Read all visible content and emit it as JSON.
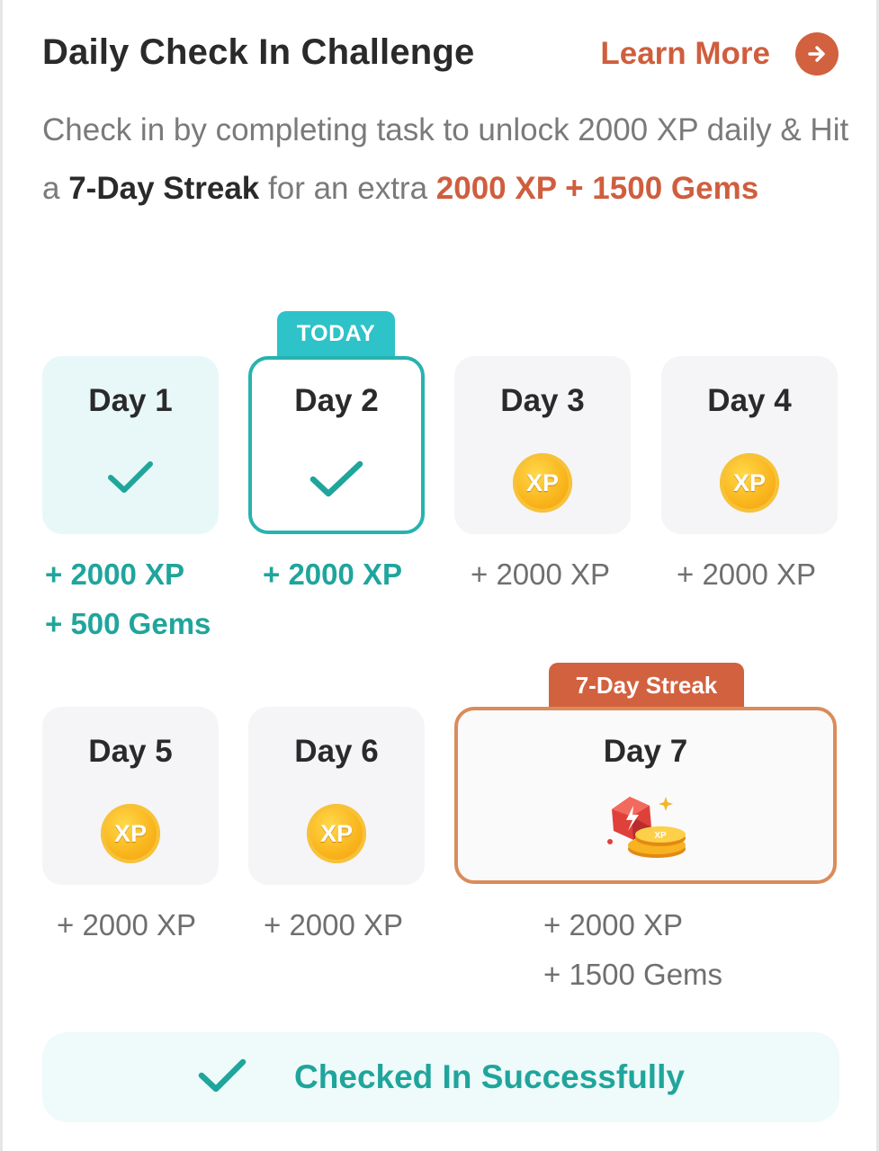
{
  "header": {
    "title": "Daily Check In Challenge",
    "learn_more": "Learn More"
  },
  "description": {
    "part1": "Check in by completing task to unlock 2000 XP daily & Hit a ",
    "streak": "7-Day Streak",
    "part2": " for an extra ",
    "bonus": "2000 XP + 1500 Gems"
  },
  "days": [
    {
      "label": "Day 1",
      "status": "checked",
      "reward_xp": "+ 2000 XP",
      "reward_gems": "+ 500 Gems"
    },
    {
      "label": "Day 2",
      "status": "checked-today",
      "badge": "TODAY",
      "reward_xp": "+ 2000 XP"
    },
    {
      "label": "Day 3",
      "status": "pending",
      "icon_text": "XP",
      "reward_xp": "+ 2000 XP"
    },
    {
      "label": "Day 4",
      "status": "pending",
      "icon_text": "XP",
      "reward_xp": "+ 2000 XP"
    },
    {
      "label": "Day 5",
      "status": "pending",
      "icon_text": "XP",
      "reward_xp": "+ 2000 XP"
    },
    {
      "label": "Day 6",
      "status": "pending",
      "icon_text": "XP",
      "reward_xp": "+ 2000 XP"
    },
    {
      "label": "Day 7",
      "status": "streak",
      "badge": "7-Day Streak",
      "icon_text": "XP",
      "reward_xp": "+ 2000 XP",
      "reward_gems": "+ 1500 Gems"
    }
  ],
  "status": {
    "checked_in": "Checked In Successfully"
  },
  "colors": {
    "accent_teal": "#1fa59c",
    "accent_orange": "#cf5e3e",
    "today_badge": "#2ec2c9"
  }
}
